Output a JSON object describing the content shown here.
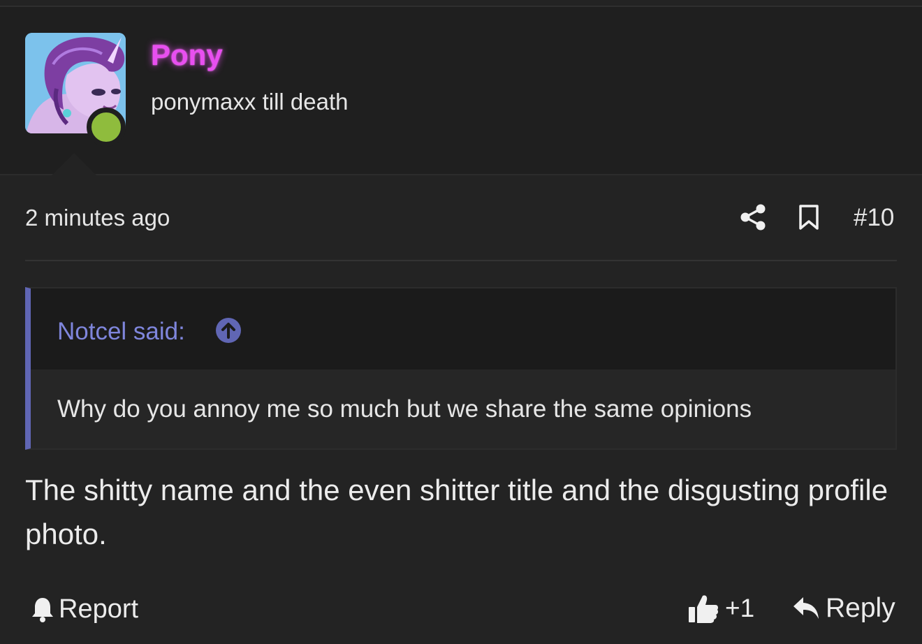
{
  "user": {
    "name": "Pony",
    "title": "ponymaxx till death",
    "name_color": "#e84ff0",
    "online_status_color": "#8fbc3d",
    "avatar": "unicorn-avatar"
  },
  "post": {
    "time": "2 minutes ago",
    "number": "#10",
    "body": "The shitty name and the even shitter title and the disgusting profile photo."
  },
  "quote": {
    "author_label": "Notcel said:",
    "text": "Why do you annoy me so much but we share the same opinions",
    "accent_color": "#6066b4"
  },
  "actions": {
    "report_label": "Report",
    "like_count": "+1",
    "reply_label": "Reply"
  },
  "icons": {
    "share": "share-icon",
    "bookmark": "bookmark-icon",
    "quote_jump": "arrow-up-circle-icon",
    "report": "bell-icon",
    "like": "thumbs-up-icon",
    "reply": "reply-arrow-icon"
  }
}
